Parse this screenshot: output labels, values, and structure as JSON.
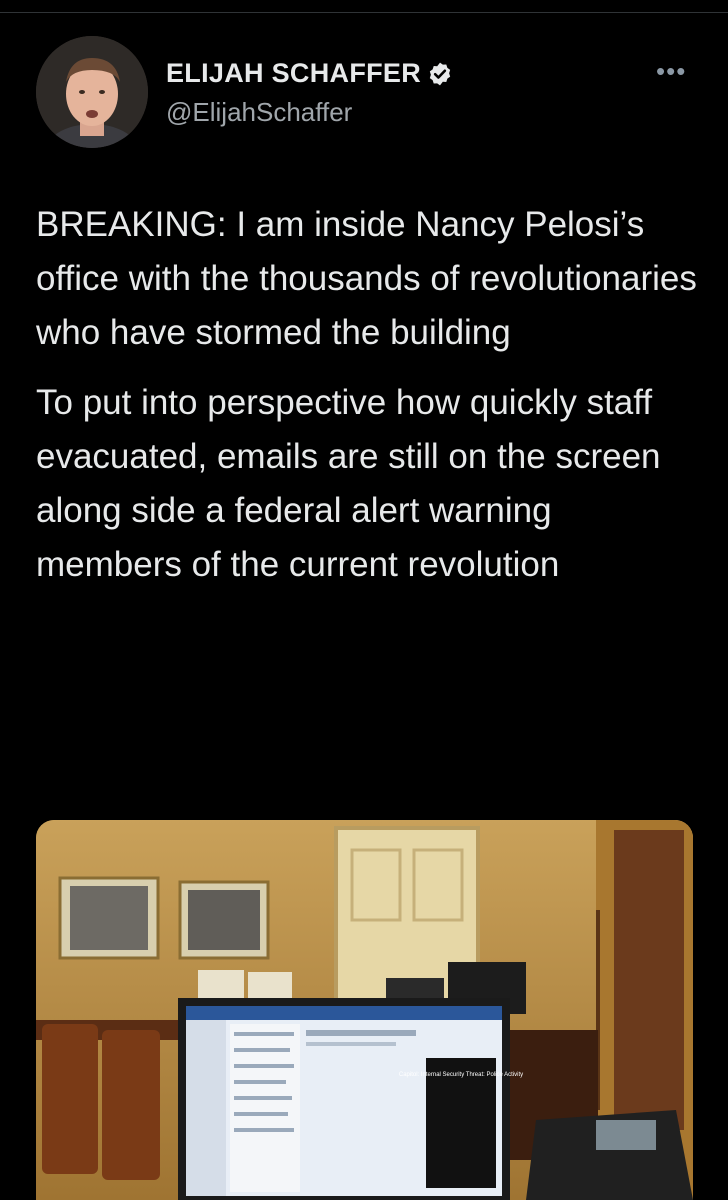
{
  "author": {
    "display_name": "ELIJAH SCHAFFER",
    "handle": "@ElijahSchaffer",
    "verified": true
  },
  "more_icon": "more-icon",
  "tweet": {
    "paragraphs": [
      "BREAKING: I am inside Nancy Pelosi’s office with the thousands of revolutionaries who have stormed the building",
      "To put into perspective how quickly staff evacuated, emails are still on the screen along side a federal alert warning members of the current revolution"
    ]
  },
  "media": {
    "screen_alert": "Capitol: Internal Security Threat: Police Activity"
  },
  "colors": {
    "background": "#000000",
    "text": "#e7e9ea",
    "secondary": "#a0a6ab",
    "verified": "#e7e9ea"
  }
}
